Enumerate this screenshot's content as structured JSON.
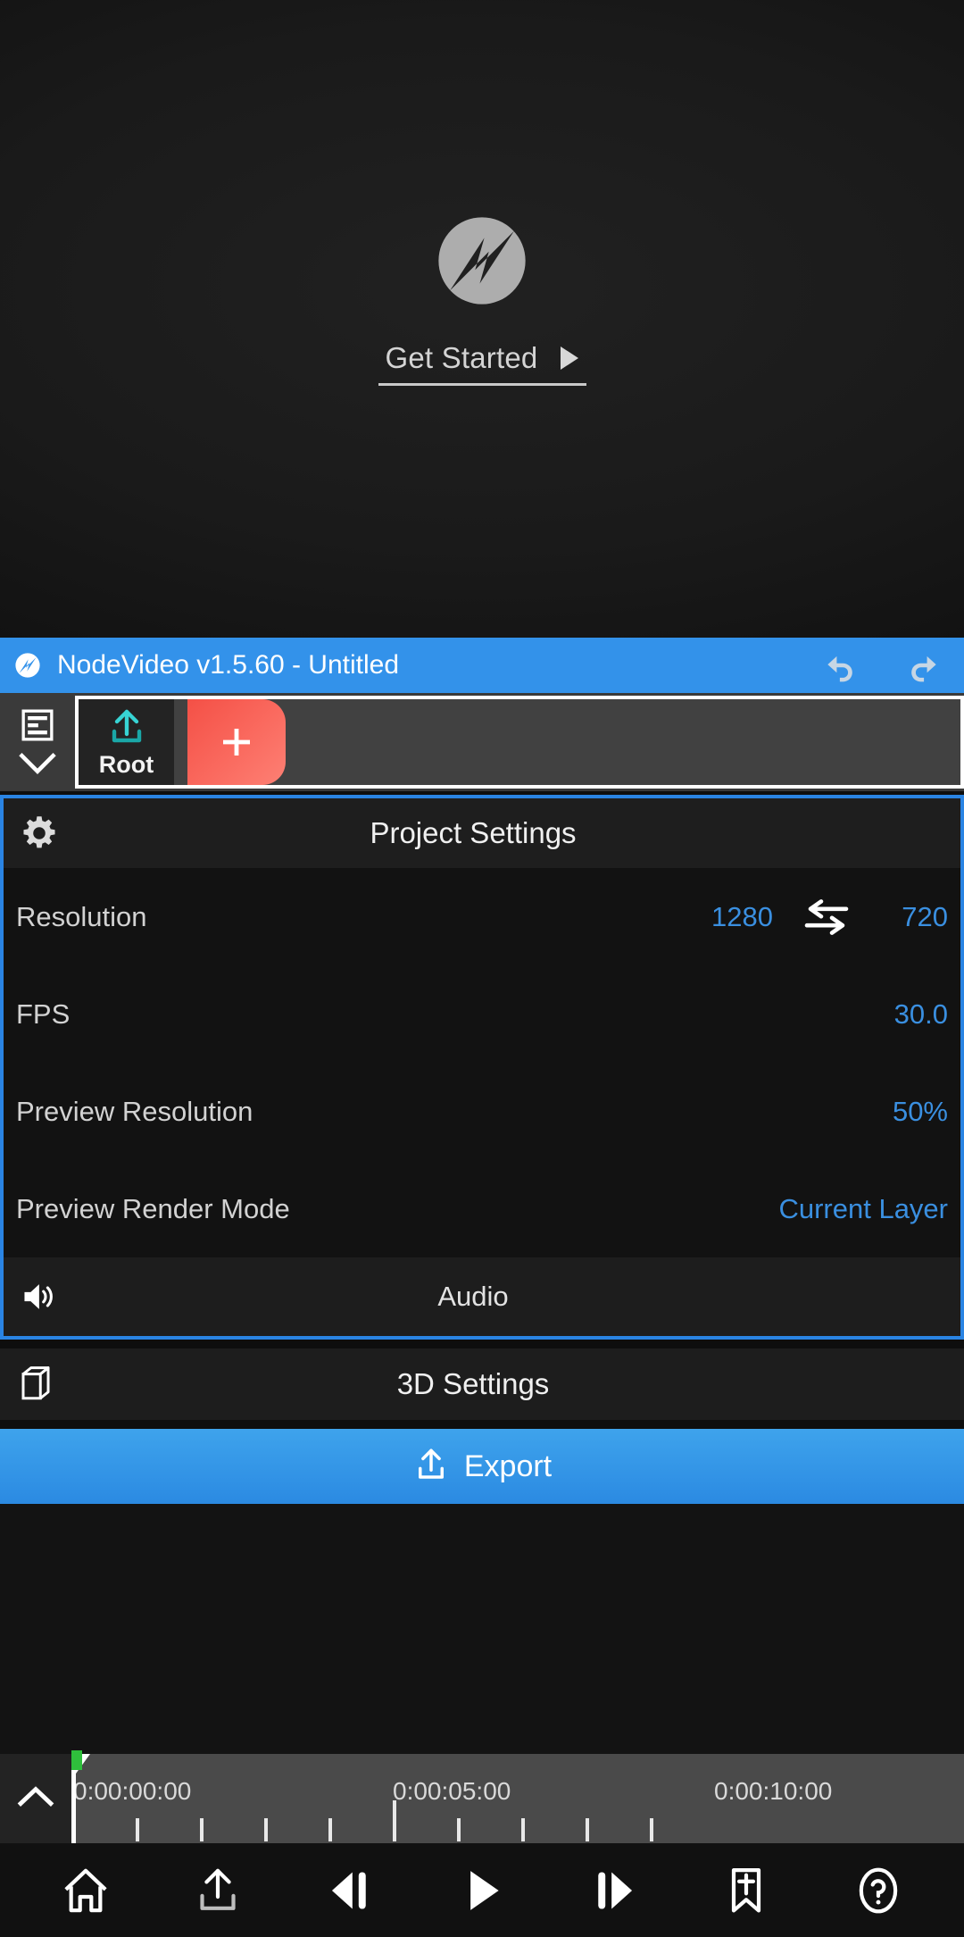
{
  "splash": {
    "logo_icon": "nodevideo-logo-icon",
    "get_started_label": "Get Started",
    "play_icon": "play-triangle-icon"
  },
  "titlebar": {
    "logo_icon": "nodevideo-logo-icon",
    "title": "NodeVideo v1.5.60 - Untitled",
    "undo_icon": "undo-arrow-icon",
    "redo_icon": "redo-arrow-icon",
    "accent_color": "#3392ea"
  },
  "layerbar": {
    "layers_icon": "layers-list-icon",
    "chevron_icon": "chevron-down-icon",
    "root_layer": {
      "label": "Root",
      "icon": "export-upload-icon"
    },
    "add_button": {
      "icon": "plus-icon",
      "color": "#f9685d"
    }
  },
  "project_settings": {
    "gear_icon": "gear-icon",
    "title": "Project Settings",
    "border_color": "#2a84e3",
    "rows": [
      {
        "label": "Resolution",
        "width": "1280",
        "swap_icon": "swap-horizontal-icon",
        "height": "720"
      },
      {
        "label": "FPS",
        "value": "30.0"
      },
      {
        "label": "Preview Resolution",
        "value": "50%"
      },
      {
        "label": "Preview Render Mode",
        "value": "Current Layer"
      }
    ],
    "audio": {
      "icon": "speaker-icon",
      "label": "Audio"
    },
    "value_color": "#3a8fe0"
  },
  "settings_3d": {
    "icon": "cube-3d-icon",
    "label": "3D Settings"
  },
  "export": {
    "icon": "export-upload-icon",
    "label": "Export",
    "color": "#2b8ae2"
  },
  "timeline": {
    "collapse_icon": "chevron-up-icon",
    "playhead_color": "#2fbf3c",
    "ticks": [
      {
        "label": "0:00:00:00",
        "x_pct": 0,
        "major": true
      },
      {
        "label": "0:00:05:00",
        "x_pct": 36,
        "major": true
      },
      {
        "label": "0:00:10:00",
        "x_pct": 72,
        "major": true
      }
    ],
    "minor_ticks_pct": [
      7.2,
      14.4,
      21.6,
      28.8,
      43.2,
      50.4,
      57.6,
      64.8
    ],
    "playhead_pct": 0
  },
  "bottombar": {
    "buttons": [
      {
        "name": "home-icon",
        "label": "Home"
      },
      {
        "name": "export-upload-icon",
        "label": "Export"
      },
      {
        "name": "prev-frame-icon",
        "label": "Previous Frame"
      },
      {
        "name": "play-icon",
        "label": "Play"
      },
      {
        "name": "next-frame-icon",
        "label": "Next Frame"
      },
      {
        "name": "bookmark-icon",
        "label": "Bookmark"
      },
      {
        "name": "help-icon",
        "label": "Help"
      }
    ]
  }
}
